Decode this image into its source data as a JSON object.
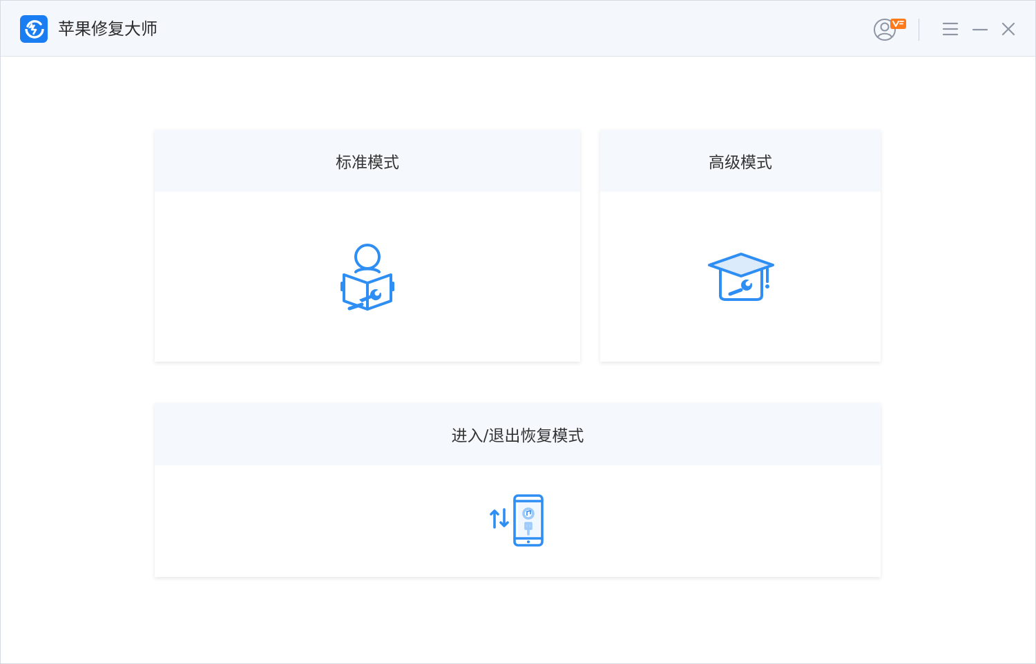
{
  "app": {
    "title": "苹果修复大师",
    "accent_color": "#1a7ef2",
    "icon_color": "#2f8ef3",
    "badge_color": "#ff7a1a"
  },
  "titlebar": {
    "controls": [
      {
        "name": "user-center",
        "icon": "user-vip-icon"
      },
      {
        "name": "menu",
        "icon": "menu-icon"
      },
      {
        "name": "minimize",
        "icon": "minimize-icon"
      },
      {
        "name": "close",
        "icon": "close-icon"
      }
    ]
  },
  "modes": {
    "standard": {
      "label": "标准模式",
      "icon": "reader-wrench-icon"
    },
    "advanced": {
      "label": "高级模式",
      "icon": "graduation-cap-wrench-icon"
    },
    "recovery": {
      "label": "进入/退出恢复模式",
      "icon": "phone-recovery-icon"
    }
  }
}
